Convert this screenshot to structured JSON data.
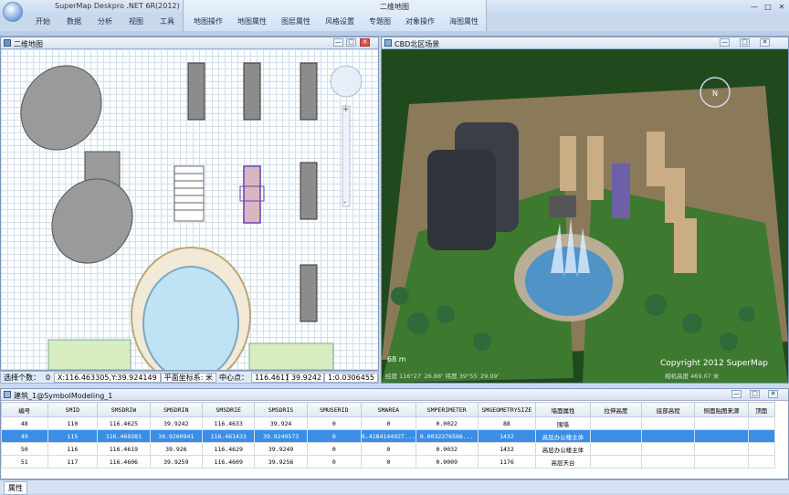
{
  "app": {
    "title": "SuperMap Deskpro .NET 6R(2012)",
    "context_title": "二维地图"
  },
  "ribbon": {
    "tabs": [
      "开始",
      "数据",
      "分析",
      "视图",
      "工具"
    ],
    "context_tabs": [
      "地图操作",
      "地图属性",
      "图层属性",
      "风格设置",
      "专题图",
      "对象操作",
      "海图属性"
    ]
  },
  "map2d": {
    "title": "二维地图",
    "status": {
      "selected_label": "选择个数：",
      "selected_value": "0",
      "coords": "X:116.463305,Y:39.924149",
      "crs_label": "平面坐标系: 米",
      "center_label": "中心点：",
      "center_x": "116.4611",
      "center_y": "39.9242",
      "scale": "1:0.0306455"
    }
  },
  "scene3d": {
    "title": "CBD北区场景",
    "altitude": "68 m",
    "copyright": "Copyright 2012 SuperMap",
    "bottom_left": "经度 116°27′ 26.88″  纬度 39°55′ 29.09″",
    "bottom_right": "相机高度 469.07 米"
  },
  "attr_table": {
    "title": "建筑_1@SymbolModeling_1",
    "columns": [
      "编号",
      "SMID",
      "SMSDRIW",
      "SMSDRIN",
      "SMSDRIE",
      "SMSDRIS",
      "SMUSERID",
      "SMAREA",
      "SMPERIMETER",
      "SMGEOMETRYSIZE",
      "墙面属性",
      "拉伸高度",
      "底部高程",
      "侧面贴图来源",
      "顶面"
    ],
    "rows": [
      [
        "48",
        "110",
        "116.4625",
        "39.9242",
        "116.4633",
        "39.924",
        "0",
        "0",
        "0.0022",
        "88",
        "围墙",
        "",
        "",
        "",
        ""
      ],
      [
        "49",
        "115",
        "116.460381",
        "39.9260941",
        "116.461433",
        "39.9249573",
        "0",
        "6.418414492T...",
        "0.0032276566...",
        "1432",
        "高层办公楼主体",
        "",
        "",
        "",
        ""
      ],
      [
        "50",
        "116",
        "116.4619",
        "39.926",
        "116.4629",
        "39.9249",
        "0",
        "0",
        "0.0032",
        "1432",
        "高层办公楼主体",
        "",
        "",
        "",
        ""
      ],
      [
        "51",
        "117",
        "116.4606",
        "39.9259",
        "116.4609",
        "39.9256",
        "0",
        "0",
        "0.0009",
        "1176",
        "高层天台",
        "",
        "",
        "",
        ""
      ]
    ],
    "selected_row": 1
  },
  "bottom": {
    "tab": "属性"
  }
}
